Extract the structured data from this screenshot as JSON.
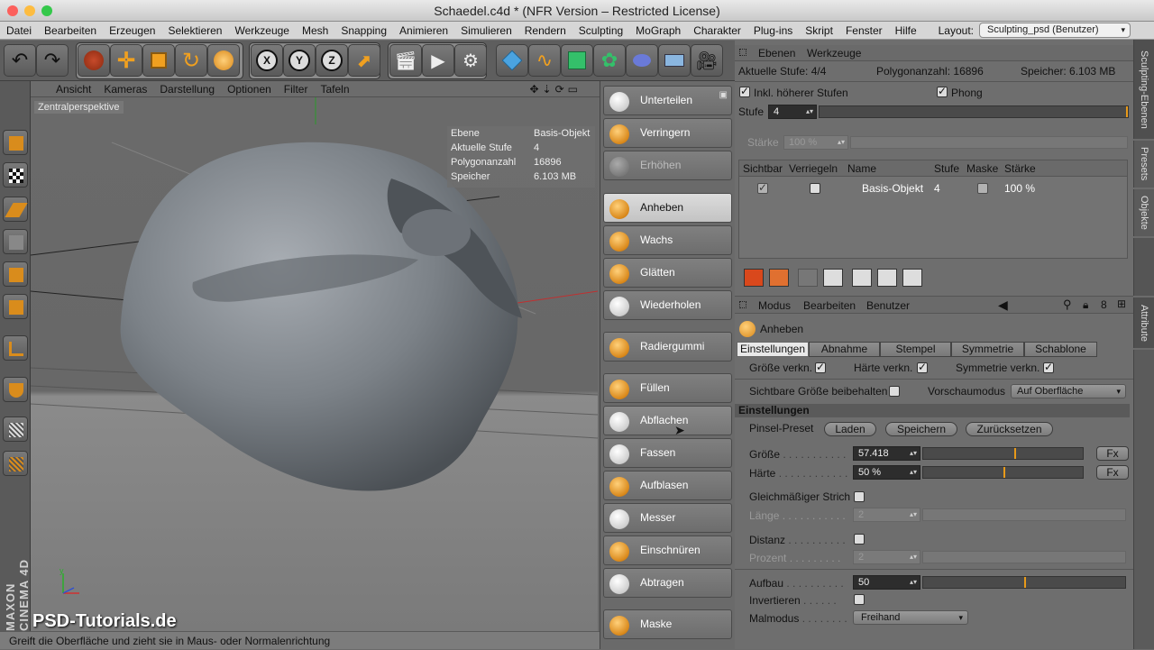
{
  "window": {
    "title": "Schaedel.c4d * (NFR Version – Restricted License)"
  },
  "menu": [
    "Datei",
    "Bearbeiten",
    "Erzeugen",
    "Selektieren",
    "Werkzeuge",
    "Mesh",
    "Snapping",
    "Animieren",
    "Simulieren",
    "Rendern",
    "Sculpting",
    "MoGraph",
    "Charakter",
    "Plug-ins",
    "Skript",
    "Fenster",
    "Hilfe"
  ],
  "layout": {
    "label": "Layout:",
    "value": "Sculpting_psd (Benutzer)"
  },
  "viewport": {
    "menu": [
      "Ansicht",
      "Kameras",
      "Darstellung",
      "Optionen",
      "Filter",
      "Tafeln"
    ],
    "camera_label": "Zentralperspektive",
    "hud": [
      {
        "k": "Ebene",
        "v": "Basis-Objekt"
      },
      {
        "k": "Aktuelle Stufe",
        "v": "4"
      },
      {
        "k": "Polygonanzahl",
        "v": "16896"
      },
      {
        "k": "Speicher",
        "v": "6.103 MB"
      }
    ],
    "watermark": "PSD-Tutorials.de",
    "brand": "MAXON CINEMA 4D"
  },
  "status": "Greift die Oberfläche und zieht sie in Maus- oder Normalenrichtung",
  "brushes": [
    {
      "label": "Unterteilen",
      "state": "normal",
      "icon": "subdivide-icon"
    },
    {
      "label": "Verringern",
      "state": "normal",
      "icon": "reduce-icon"
    },
    {
      "label": "Erhöhen",
      "state": "dim",
      "icon": "increase-icon"
    },
    {
      "label": "Anheben",
      "state": "active",
      "icon": "pull-brush-icon"
    },
    {
      "label": "Wachs",
      "state": "normal",
      "icon": "wax-brush-icon"
    },
    {
      "label": "Glätten",
      "state": "normal",
      "icon": "smooth-brush-icon"
    },
    {
      "label": "Wiederholen",
      "state": "normal",
      "icon": "repeat-brush-icon"
    },
    {
      "label": "Radiergummi",
      "state": "normal",
      "icon": "eraser-brush-icon"
    },
    {
      "label": "Füllen",
      "state": "normal",
      "icon": "fill-brush-icon"
    },
    {
      "label": "Abflachen",
      "state": "hover",
      "icon": "flatten-brush-icon"
    },
    {
      "label": "Fassen",
      "state": "normal",
      "icon": "grab-brush-icon"
    },
    {
      "label": "Aufblasen",
      "state": "normal",
      "icon": "inflate-brush-icon"
    },
    {
      "label": "Messer",
      "state": "normal",
      "icon": "knife-brush-icon"
    },
    {
      "label": "Einschnüren",
      "state": "normal",
      "icon": "pinch-brush-icon"
    },
    {
      "label": "Abtragen",
      "state": "normal",
      "icon": "scrape-brush-icon"
    },
    {
      "label": "Maske",
      "state": "normal",
      "icon": "mask-brush-icon"
    }
  ],
  "layers_panel": {
    "tabs": [
      "Ebenen",
      "Werkzeuge"
    ],
    "info": {
      "stufe": "Aktuelle Stufe: 4/4",
      "poly": "Polygonanzahl: 16896",
      "mem": "Speicher: 6.103 MB"
    },
    "incl_higher": "Inkl. höherer Stufen",
    "phong": "Phong",
    "stufe_label": "Stufe",
    "stufe_value": "4",
    "staerke_label": "Stärke",
    "staerke_value": "100 %",
    "columns": [
      "Sichtbar",
      "Verriegeln",
      "Name",
      "Stufe",
      "Maske",
      "Stärke"
    ],
    "rows": [
      {
        "name": "Basis-Objekt",
        "stufe": "4",
        "staerke": "100 %"
      }
    ]
  },
  "side_tabs": [
    "Sculpting-Ebenen",
    "Presets",
    "Objekte",
    "Attribute"
  ],
  "attributes": {
    "menu": [
      "Modus",
      "Bearbeiten",
      "Benutzer"
    ],
    "tool": "Anheben",
    "subtabs": [
      "Einstellungen",
      "Abnahme",
      "Stempel",
      "Symmetrie",
      "Schablone"
    ],
    "links": {
      "size": "Größe verkn.",
      "hard": "Härte verkn.",
      "sym": "Symmetrie verkn."
    },
    "keep_size": "Sichtbare Größe beibehalten",
    "preview_label": "Vorschaumodus",
    "preview_value": "Auf Oberfläche",
    "section": "Einstellungen",
    "preset_label": "Pinsel-Preset",
    "preset_buttons": [
      "Laden",
      "Speichern",
      "Zurücksetzen"
    ],
    "size_label": "Größe",
    "size_value": "57.418",
    "size_frac": 0.57,
    "hard_label": "Härte",
    "hard_value": "50 %",
    "hard_frac": 0.5,
    "fx": "Fx",
    "even_stroke": "Gleichmäßiger Strich",
    "length_label": "Länge",
    "length_value": "2",
    "distance_label": "Distanz",
    "percent_label": "Prozent",
    "percent_value": "2",
    "build_label": "Aufbau",
    "build_value": "50",
    "build_frac": 0.5,
    "invert_label": "Invertieren",
    "paint_label": "Malmodus",
    "paint_value": "Freihand"
  },
  "colors": {
    "accent": "#e89a1a",
    "brush_orange": "#d9881a"
  }
}
